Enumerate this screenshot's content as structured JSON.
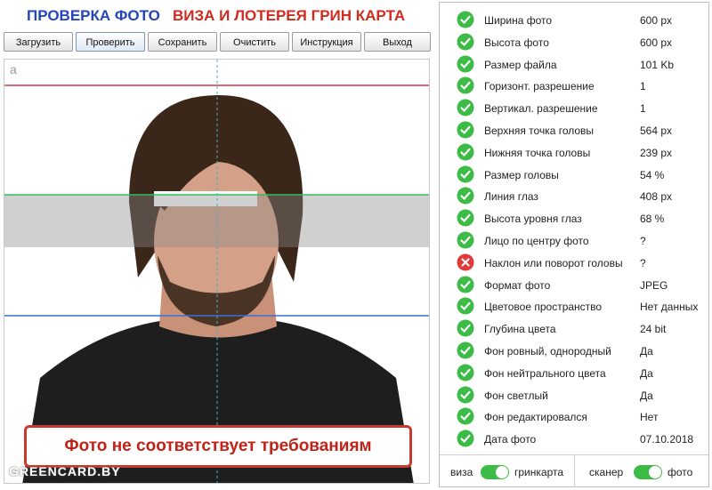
{
  "header": {
    "title_blue": "ПРОВЕРКА ФОТО",
    "title_red": "ВИЗА И ЛОТЕРЕЯ ГРИН КАРТА"
  },
  "toolbar": {
    "buttons": [
      "Загрузить",
      "Проверить",
      "Сохранить",
      "Очистить",
      "Инструкция",
      "Выход"
    ]
  },
  "photo": {
    "corner_letter": "a",
    "warning": "Фото не соответствует требованиям",
    "watermark": "GREENCARD.BY"
  },
  "checks": [
    {
      "label": "Ширина фото",
      "value": "600 px",
      "status": "ok"
    },
    {
      "label": "Высота фото",
      "value": "600 px",
      "status": "ok"
    },
    {
      "label": "Размер файла",
      "value": "101 Kb",
      "status": "ok"
    },
    {
      "label": "Горизонт. разрешение",
      "value": "1",
      "status": "ok"
    },
    {
      "label": "Вертикал. разрешение",
      "value": "1",
      "status": "ok"
    },
    {
      "label": "Верхняя точка головы",
      "value": "564 px",
      "status": "ok"
    },
    {
      "label": "Нижняя точка головы",
      "value": "239 px",
      "status": "ok"
    },
    {
      "label": "Размер головы",
      "value": "54 %",
      "status": "ok"
    },
    {
      "label": "Линия глаз",
      "value": "408 px",
      "status": "ok"
    },
    {
      "label": "Высота уровня глаз",
      "value": "68 %",
      "status": "ok"
    },
    {
      "label": "Лицо по центру фото",
      "value": "?",
      "status": "ok"
    },
    {
      "label": "Наклон или поворот головы",
      "value": "?",
      "status": "fail"
    },
    {
      "label": "Формат фото",
      "value": "JPEG",
      "status": "ok"
    },
    {
      "label": "Цветовое пространство",
      "value": "Нет данных",
      "status": "ok"
    },
    {
      "label": "Глубина цвета",
      "value": "24 bit",
      "status": "ok"
    },
    {
      "label": "Фон ровный, однородный",
      "value": "Да",
      "status": "ok"
    },
    {
      "label": "Фон нейтрального цвета",
      "value": "Да",
      "status": "ok"
    },
    {
      "label": "Фон светлый",
      "value": "Да",
      "status": "ok"
    },
    {
      "label": "Фон редактировался",
      "value": "Нет",
      "status": "ok"
    },
    {
      "label": "Дата фото",
      "value": "07.10.2018",
      "status": "ok"
    }
  ],
  "toggles": {
    "left": {
      "label_off": "виза",
      "label_on": "гринкарта",
      "on": true
    },
    "right": {
      "label_off": "сканер",
      "label_on": "фото",
      "on": true
    }
  },
  "colors": {
    "ok": "#3cbb46",
    "fail": "#e03a3a",
    "title_blue": "#2446b8",
    "title_red": "#d12a1e"
  }
}
